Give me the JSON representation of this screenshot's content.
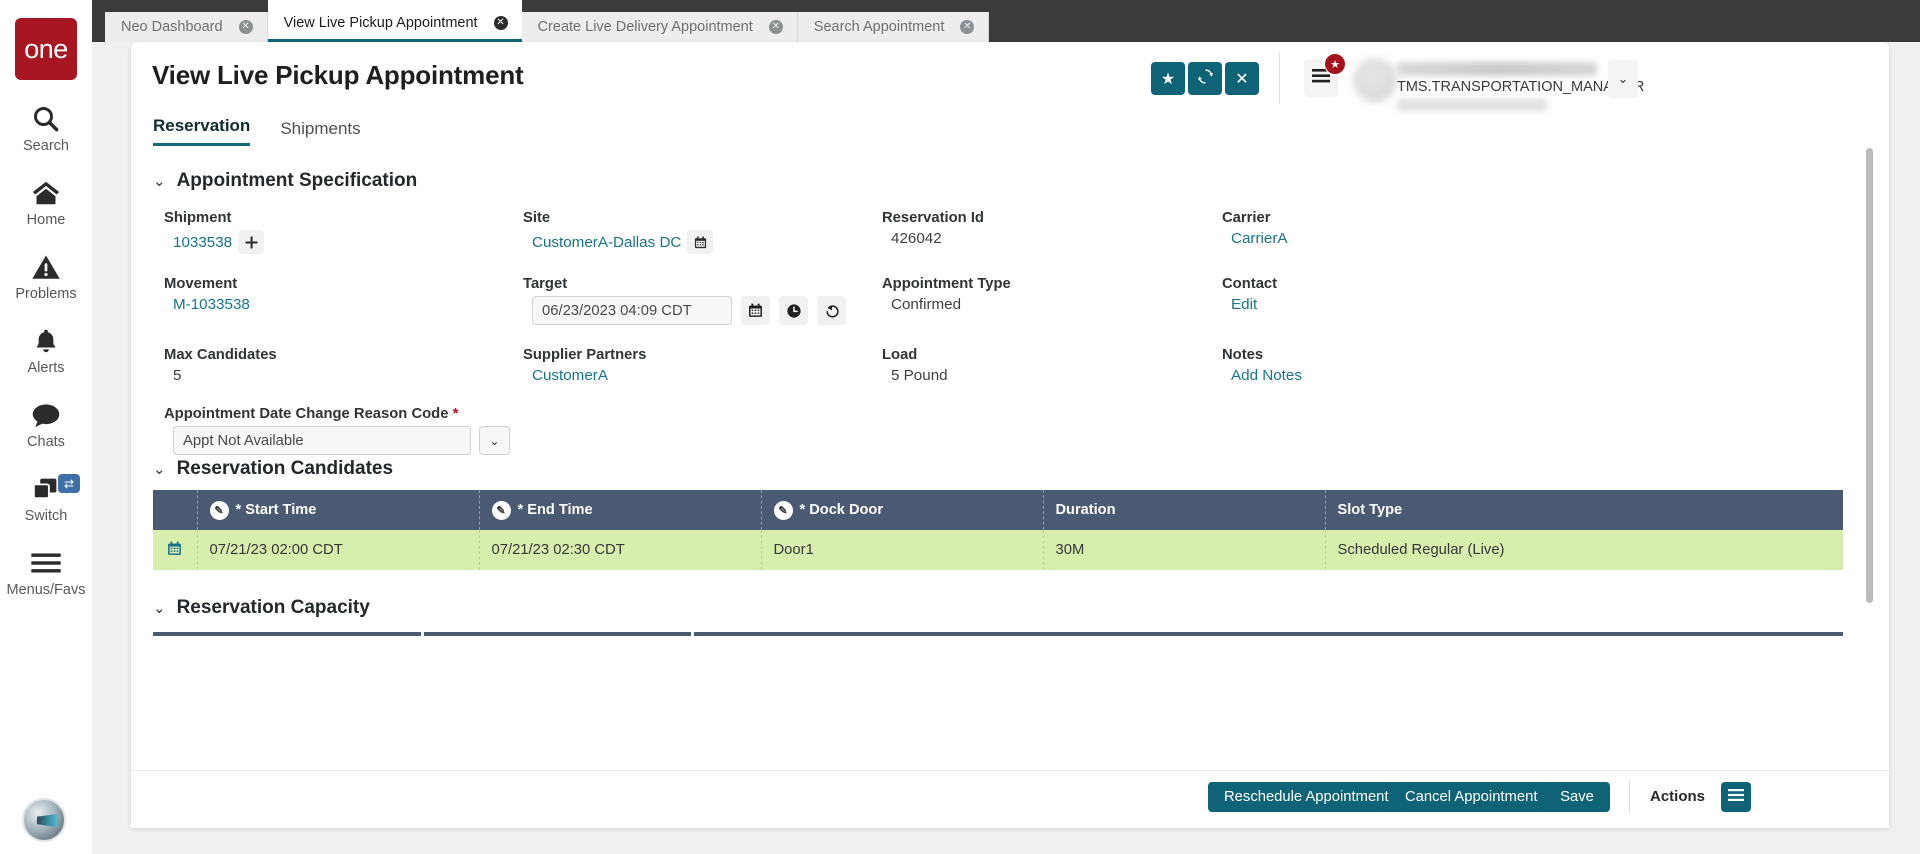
{
  "brand": {
    "logo_text": "one"
  },
  "sidebar": {
    "items": [
      {
        "label": "Search",
        "icon": "search-icon"
      },
      {
        "label": "Home",
        "icon": "home-icon"
      },
      {
        "label": "Problems",
        "icon": "warning-icon"
      },
      {
        "label": "Alerts",
        "icon": "bell-icon"
      },
      {
        "label": "Chats",
        "icon": "chat-icon"
      },
      {
        "label": "Switch",
        "icon": "windows-icon",
        "badge_icon": "swap-arrows-icon"
      },
      {
        "label": "Menus/Favs",
        "icon": "hamburger-icon"
      }
    ]
  },
  "browser_tabs": [
    {
      "label": "Neo Dashboard",
      "active": false
    },
    {
      "label": "View Live Pickup Appointment",
      "active": true
    },
    {
      "label": "Create Live Delivery Appointment",
      "active": false
    },
    {
      "label": "Search Appointment",
      "active": false
    }
  ],
  "header": {
    "title": "View Live Pickup Appointment",
    "buttons": [
      {
        "name": "favorite-button",
        "icon": "star-icon"
      },
      {
        "name": "refresh-button",
        "icon": "refresh-icon"
      },
      {
        "name": "close-button",
        "icon": "x-icon"
      }
    ],
    "menu_badge_icon": "star-icon",
    "user_role": "TMS.TRANSPORTATION_MANAGER",
    "caret_icon": "chevron-down-icon",
    "accent_color": "#0f6377"
  },
  "view_tabs": [
    {
      "label": "Reservation",
      "active": true
    },
    {
      "label": "Shipments",
      "active": false
    }
  ],
  "sections": {
    "appointment_specification": "Appointment Specification",
    "reservation_candidates": "Reservation Candidates",
    "reservation_capacity": "Reservation Capacity"
  },
  "fields": {
    "shipment": {
      "label": "Shipment",
      "value": "1033538",
      "add_icon": "plus-icon"
    },
    "site": {
      "label": "Site",
      "value": "CustomerA-Dallas DC",
      "calendar_icon": "calendar-icon"
    },
    "reservation_id": {
      "label": "Reservation Id",
      "value": "426042"
    },
    "carrier": {
      "label": "Carrier",
      "value": "CarrierA"
    },
    "movement": {
      "label": "Movement",
      "value": "M-1033538"
    },
    "target": {
      "label": "Target",
      "value": "06/23/2023 04:09 CDT",
      "icons": [
        "calendar-icon",
        "clock-icon",
        "revert-icon"
      ]
    },
    "appointment_type": {
      "label": "Appointment Type",
      "value": "Confirmed"
    },
    "contact": {
      "label": "Contact",
      "value": "Edit"
    },
    "max_candidates": {
      "label": "Max Candidates",
      "value": "5"
    },
    "supplier_partners": {
      "label": "Supplier Partners",
      "value": "CustomerA"
    },
    "load": {
      "label": "Load",
      "value": "5 Pound"
    },
    "notes": {
      "label": "Notes",
      "value": "Add Notes"
    },
    "reason_code": {
      "label": "Appointment Date Change Reason Code",
      "required_marker": "*",
      "value": "Appt Not Available",
      "caret_icon": "chevron-down-icon"
    }
  },
  "candidates_table": {
    "columns": [
      {
        "label": "",
        "editable": false
      },
      {
        "label": "* Start Time",
        "editable": true
      },
      {
        "label": "* End Time",
        "editable": true
      },
      {
        "label": "* Dock Door",
        "editable": true
      },
      {
        "label": "Duration",
        "editable": false
      },
      {
        "label": "Slot Type",
        "editable": false
      }
    ],
    "rows": [
      {
        "row_icon": "calendar-icon",
        "start_time": "07/21/23 02:00 CDT",
        "end_time": "07/21/23 02:30 CDT",
        "dock_door": "Door1",
        "duration": "30M",
        "slot_type": "Scheduled Regular (Live)"
      }
    ],
    "header_color": "#4a5a72",
    "row_color": "#d7eeac"
  },
  "footer": {
    "reschedule_label": "Reschedule Appointment",
    "cancel_label": "Cancel Appointment",
    "save_label": "Save",
    "actions_label": "Actions",
    "actions_icon": "hamburger-icon"
  }
}
